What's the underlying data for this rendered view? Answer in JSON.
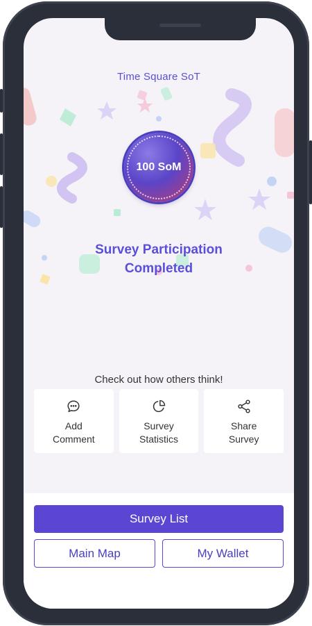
{
  "app": {
    "title": "Time Square SoT"
  },
  "reward": {
    "badge_text": "100 SoM"
  },
  "status": {
    "line1": "Survey Participation",
    "line2": "Completed"
  },
  "prompt": "Check out how others think!",
  "actions": [
    {
      "icon": "comment-icon",
      "line1": "Add",
      "line2": "Comment"
    },
    {
      "icon": "pie-chart-icon",
      "line1": "Survey",
      "line2": "Statistics"
    },
    {
      "icon": "share-icon",
      "line1": "Share",
      "line2": "Survey"
    }
  ],
  "buttons": {
    "survey_list": "Survey List",
    "main_map": "Main Map",
    "my_wallet": "My Wallet"
  },
  "colors": {
    "accent": "#5a46d3",
    "background": "#f5f3f7",
    "frame": "#2b2f3a"
  }
}
